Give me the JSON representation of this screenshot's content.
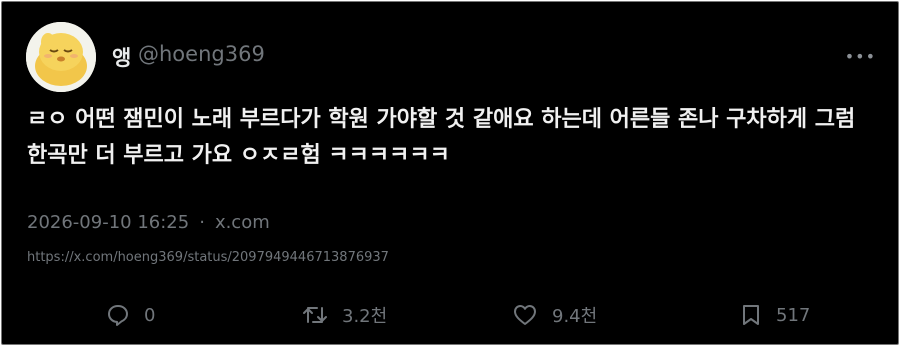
{
  "author": {
    "name": "앵",
    "handle": "@hoeng369"
  },
  "tweet": {
    "text": "ㄹㅇ 어떤 잼민이 노래 부르다가 학원 가야할 것 같애요 하는데 어른들 존나 구차하게 그럼 한곡만 더 부르고 가요 ㅇㅈㄹ험 ㅋㅋㅋㅋㅋㅋ",
    "timestamp": "2026-09-10 16:25",
    "separator": "·",
    "source": "x.com",
    "url": "https://x.com/hoeng369/status/2097949446713876937"
  },
  "actions": {
    "replies": "0",
    "retweets": "3.2천",
    "likes": "9.4천",
    "bookmarks": "517"
  },
  "icons": {
    "more": "more-icon",
    "reply": "reply-icon",
    "retweet": "retweet-icon",
    "like": "heart-icon",
    "bookmark": "bookmark-icon"
  },
  "colors": {
    "background": "#000000",
    "text": "#f1f1f1",
    "muted": "#71767b"
  }
}
